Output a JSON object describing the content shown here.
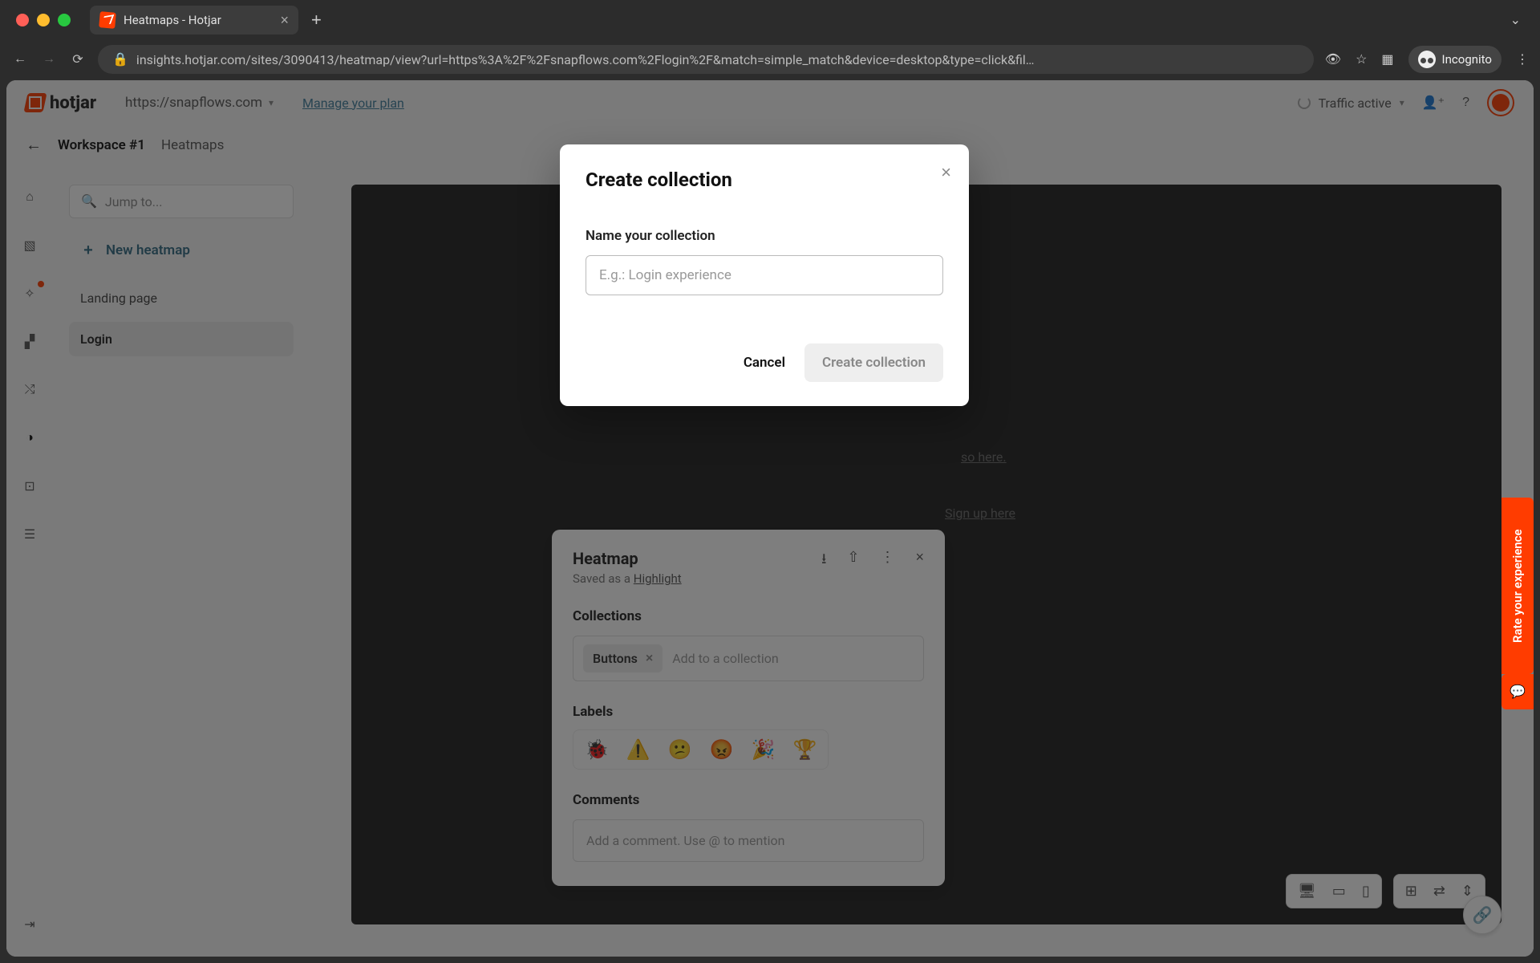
{
  "browser": {
    "tab_title": "Heatmaps - Hotjar",
    "url_display": "insights.hotjar.com/sites/3090413/heatmap/view?url=https%3A%2F%2Fsnapflows.com%2Flogin%2F&match=simple_match&device=desktop&type=click&fil…",
    "incognito_label": "Incognito"
  },
  "app_header": {
    "logo_text": "hotjar",
    "site_selector": "https://snapflows.com",
    "manage_plan": "Manage your plan",
    "traffic_status": "Traffic active"
  },
  "breadcrumb": {
    "workspace": "Workspace #1",
    "page": "Heatmaps"
  },
  "side_panel": {
    "jump_placeholder": "Jump to...",
    "new_heatmap": "New heatmap",
    "items": [
      "Landing page",
      "Login"
    ]
  },
  "highlight_panel": {
    "title": "Heatmap",
    "saved_prefix": "Saved as a ",
    "saved_link": "Highlight",
    "collections_label": "Collections",
    "chip": "Buttons",
    "add_placeholder": "Add to a collection",
    "labels_label": "Labels",
    "emojis": [
      "🐞",
      "⚠️",
      "😕",
      "😡",
      "🎉",
      "🏆"
    ],
    "comments_label": "Comments",
    "comments_placeholder": "Add a comment. Use @ to mention"
  },
  "bg_link_1": "so here.",
  "bg_link_2": "Sign up here",
  "rate_tab": "Rate your experience",
  "modal": {
    "title": "Create collection",
    "field_label": "Name your collection",
    "placeholder": "E.g.: Login experience",
    "cancel": "Cancel",
    "create": "Create collection"
  }
}
